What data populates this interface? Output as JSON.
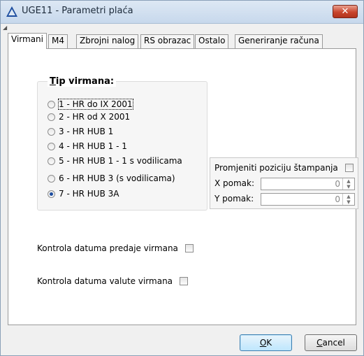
{
  "window": {
    "title": "UGE11 - Parametri plaća",
    "close_label": "✕"
  },
  "tabs": [
    {
      "label": "Virmani",
      "active": true
    },
    {
      "label": "M4",
      "active": false
    },
    {
      "label": "Zbrojni nalog",
      "active": false
    },
    {
      "label": "RS obrazac",
      "active": false
    },
    {
      "label": "Ostalo",
      "active": false
    },
    {
      "label": "Generiranje računa",
      "active": false
    }
  ],
  "tip_virmana": {
    "title_prefix": "T",
    "title_rest": "ip virmana:",
    "options": [
      {
        "label": "1 - HR do IX 2001",
        "selected": false,
        "focused": true
      },
      {
        "label": "2 - HR od X 2001",
        "selected": false
      },
      {
        "label": "3 - HR HUB 1",
        "selected": false
      },
      {
        "label": "4 - HR HUB 1 - 1",
        "selected": false
      },
      {
        "label": "5 - HR HUB 1 - 1 s vodilicama",
        "selected": false
      },
      {
        "label": "6 - HR HUB 3 (s vodilicama)",
        "selected": false
      },
      {
        "label": "7 - HR HUB 3A",
        "selected": true
      }
    ]
  },
  "print_position": {
    "label": "Promjeniti poziciju štampanja",
    "checked": false,
    "x_label": "X pomak:",
    "x_value": "0",
    "y_label": "Y pomak:",
    "y_value": "0"
  },
  "options": {
    "kontrola_predaje": {
      "label": "Kontrola datuma predaje virmana",
      "checked": false
    },
    "kontrola_valute": {
      "label": "Kontrola datuma valute virmana",
      "checked": false
    }
  },
  "buttons": {
    "ok_prefix": "O",
    "ok_rest": "K",
    "cancel_prefix": "C",
    "cancel_rest": "ancel"
  }
}
